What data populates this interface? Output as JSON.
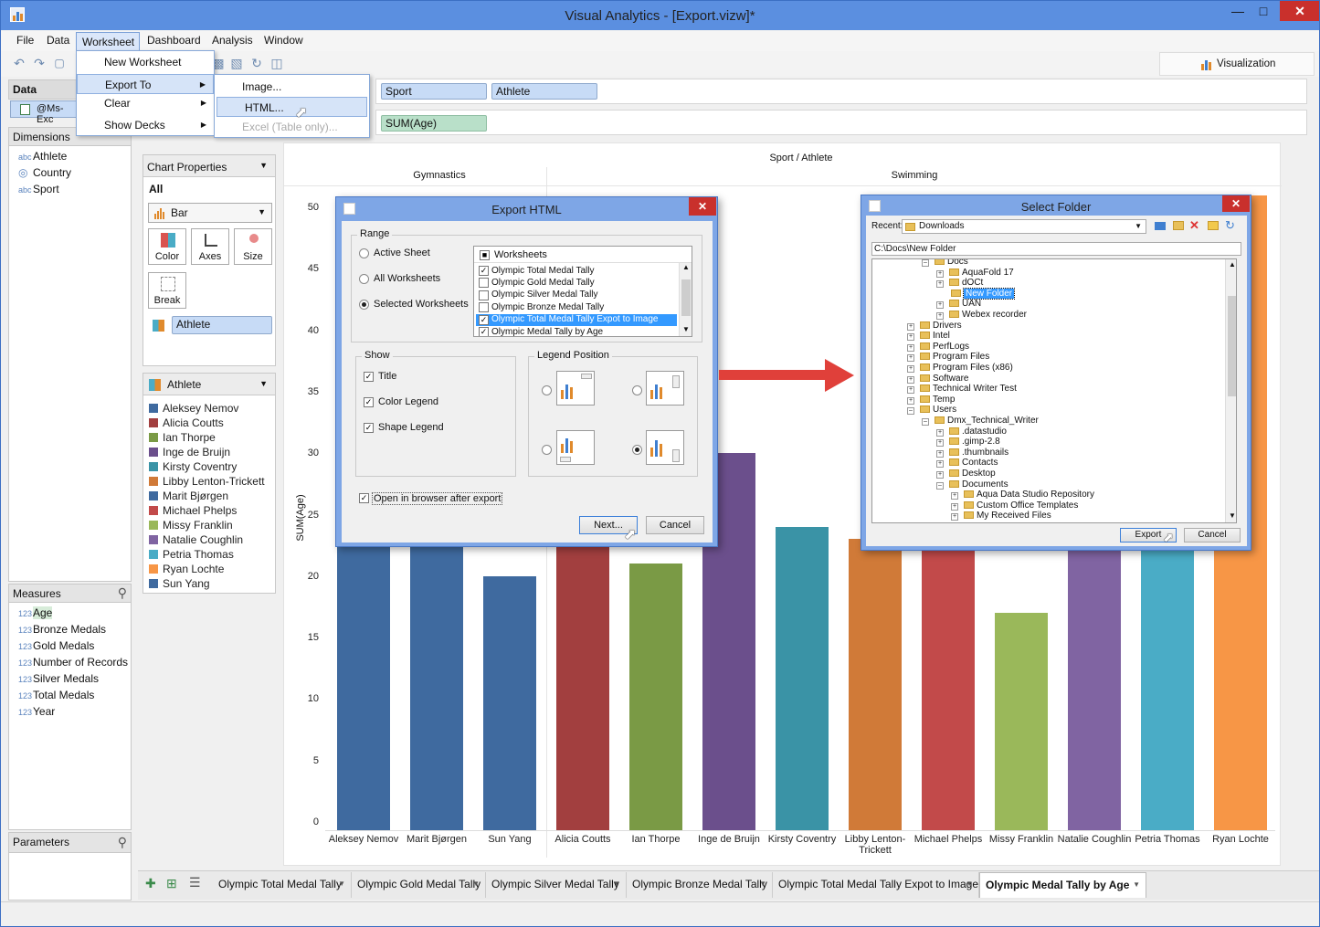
{
  "window": {
    "title": "Visual Analytics - [Export.vizw]*"
  },
  "menubar": [
    "File",
    "Data",
    "Worksheet",
    "Dashboard",
    "Analysis",
    "Window"
  ],
  "worksheet_menu": {
    "items": [
      "New Worksheet",
      "Export To",
      "Clear",
      "Show Decks"
    ],
    "export_submenu": [
      "Image...",
      "HTML...",
      "Excel (Table only)..."
    ]
  },
  "toolbar": {
    "visualization_label": "Visualization"
  },
  "data_panel": {
    "title": "Data",
    "connection": "@Ms-Exc",
    "dimensions_title": "Dimensions",
    "dimensions": [
      {
        "type": "abc",
        "name": "Athlete"
      },
      {
        "type": "globe",
        "name": "Country"
      },
      {
        "type": "abc",
        "name": "Sport"
      }
    ],
    "measures_title": "Measures",
    "measures": [
      {
        "type": "123",
        "name": "Age"
      },
      {
        "type": "123",
        "name": "Bronze Medals"
      },
      {
        "type": "123",
        "name": "Gold Medals"
      },
      {
        "type": "123",
        "name": "Number of Records"
      },
      {
        "type": "123",
        "name": "Silver Medals"
      },
      {
        "type": "123",
        "name": "Total Medals"
      },
      {
        "type": "123",
        "name": "Year"
      }
    ],
    "parameters_title": "Parameters"
  },
  "shelves": {
    "columns": [
      "Sport",
      "Athlete"
    ],
    "rows": [
      "SUM(Age)"
    ]
  },
  "chart_properties": {
    "title": "Chart Properties",
    "scope": "All",
    "chart_type": "Bar",
    "buttons": [
      "Color",
      "Axes",
      "Size",
      "Break"
    ],
    "color_field": "Athlete"
  },
  "legend": {
    "title": "Athlete",
    "items": [
      {
        "name": "Aleksey Nemov",
        "color": "#3f6a9f"
      },
      {
        "name": "Alicia Coutts",
        "color": "#a23f3f"
      },
      {
        "name": "Ian Thorpe",
        "color": "#7a9a45"
      },
      {
        "name": "Inge de Bruijn",
        "color": "#6b4f8c"
      },
      {
        "name": "Kirsty Coventry",
        "color": "#3a93a6"
      },
      {
        "name": "Libby Lenton-Trickett",
        "color": "#d07a38"
      },
      {
        "name": "Marit Bjørgen",
        "color": "#3f6a9f"
      },
      {
        "name": "Michael Phelps",
        "color": "#c24a4a"
      },
      {
        "name": "Missy Franklin",
        "color": "#9ab85a"
      },
      {
        "name": "Natalie Coughlin",
        "color": "#8064a2"
      },
      {
        "name": "Petria Thomas",
        "color": "#4aacc6"
      },
      {
        "name": "Ryan Lochte",
        "color": "#f79646"
      },
      {
        "name": "Sun Yang",
        "color": "#3f6a9f"
      }
    ]
  },
  "chart_data": {
    "type": "bar",
    "title": "Sport / Athlete",
    "ylabel": "SUM(Age)",
    "ylim": [
      0,
      50
    ],
    "yticks": [
      0,
      5,
      10,
      15,
      20,
      25,
      30,
      35,
      40,
      45,
      50
    ],
    "groups": [
      {
        "name": "Gymnastics",
        "count": 3
      },
      {
        "name": "Swimming",
        "count": 10
      }
    ],
    "categories": [
      "Aleksey Nemov",
      "Marit Bjørgen",
      "Sun Yang",
      "Alicia Coutts",
      "Ian Thorpe",
      "Inge de Bruijn",
      "Kirsty Coventry",
      "Libby Lenton-Trickett",
      "Michael Phelps",
      "Missy Franklin",
      "Natalie Coughlin",
      "Petria Thomas",
      "Ryan Lochte"
    ],
    "values": [
      28,
      28,
      20,
      28,
      21,
      30,
      24,
      23,
      28,
      17,
      28,
      28,
      51
    ],
    "colors": [
      "#3f6a9f",
      "#3f6a9f",
      "#3f6a9f",
      "#a23f3f",
      "#7a9a45",
      "#6b4f8c",
      "#3a93a6",
      "#d07a38",
      "#c24a4a",
      "#9ab85a",
      "#8064a2",
      "#4aacc6",
      "#f79646"
    ]
  },
  "export_html_dialog": {
    "title": "Export HTML",
    "range_title": "Range",
    "range_options": [
      "Active Sheet",
      "All Worksheets",
      "Selected Worksheets"
    ],
    "selected_range": "Selected Worksheets",
    "worksheets_header": "Worksheets",
    "worksheets": [
      {
        "name": "Olympic Total Medal Tally",
        "checked": true
      },
      {
        "name": "Olympic Gold Medal Tally",
        "checked": false
      },
      {
        "name": "Olympic Silver Medal Tally",
        "checked": false
      },
      {
        "name": "Olympic Bronze Medal Tally",
        "checked": false
      },
      {
        "name": "Olympic Total Medal Tally Expot to Image",
        "checked": true
      },
      {
        "name": "Olympic Medal Tally by Age",
        "checked": true
      }
    ],
    "show_title": "Show",
    "show_options": [
      "Title",
      "Color Legend",
      "Shape Legend"
    ],
    "legend_position_title": "Legend Position",
    "open_in_browser": "Open in browser after export",
    "next_label": "Next...",
    "cancel_label": "Cancel"
  },
  "select_folder_dialog": {
    "title": "Select Folder",
    "recent_label": "Recent:",
    "recent_value": "Downloads",
    "path": "C:\\Docs\\New Folder",
    "tree": [
      {
        "level": 2,
        "name": "Docs",
        "sign": "-"
      },
      {
        "level": 3,
        "name": "AquaFold 17",
        "sign": "+"
      },
      {
        "level": 3,
        "name": "dOCt",
        "sign": "+"
      },
      {
        "level": 3,
        "name": "New Folder",
        "sign": "",
        "selected": true
      },
      {
        "level": 3,
        "name": "UAN",
        "sign": "+"
      },
      {
        "level": 3,
        "name": "Webex recorder",
        "sign": "+"
      },
      {
        "level": 1,
        "name": "Drivers",
        "sign": "+"
      },
      {
        "level": 1,
        "name": "Intel",
        "sign": "+"
      },
      {
        "level": 1,
        "name": "PerfLogs",
        "sign": "+"
      },
      {
        "level": 1,
        "name": "Program Files",
        "sign": "+"
      },
      {
        "level": 1,
        "name": "Program Files (x86)",
        "sign": "+"
      },
      {
        "level": 1,
        "name": "Software",
        "sign": "+"
      },
      {
        "level": 1,
        "name": "Technical Writer Test",
        "sign": "+"
      },
      {
        "level": 1,
        "name": "Temp",
        "sign": "+"
      },
      {
        "level": 1,
        "name": "Users",
        "sign": "-"
      },
      {
        "level": 2,
        "name": "Dmx_Technical_Writer",
        "sign": "-"
      },
      {
        "level": 3,
        "name": ".datastudio",
        "sign": "+"
      },
      {
        "level": 3,
        "name": ".gimp-2.8",
        "sign": "+"
      },
      {
        "level": 3,
        "name": ".thumbnails",
        "sign": "+"
      },
      {
        "level": 3,
        "name": "Contacts",
        "sign": "+"
      },
      {
        "level": 3,
        "name": "Desktop",
        "sign": "+"
      },
      {
        "level": 3,
        "name": "Documents",
        "sign": "-"
      },
      {
        "level": 4,
        "name": "Aqua Data Studio Repository",
        "sign": "+"
      },
      {
        "level": 4,
        "name": "Custom Office Templates",
        "sign": "+"
      },
      {
        "level": 4,
        "name": "My Received Files",
        "sign": "+"
      }
    ],
    "export_label": "Export",
    "cancel_label": "Cancel"
  },
  "tabs": [
    {
      "name": "Olympic Total Medal Tally",
      "active": false
    },
    {
      "name": "Olympic Gold Medal Tally",
      "active": false
    },
    {
      "name": "Olympic Silver Medal Tally",
      "active": false
    },
    {
      "name": "Olympic Bronze Medal Tally",
      "active": false
    },
    {
      "name": "Olympic Total Medal Tally Expot to Image",
      "active": false
    },
    {
      "name": "Olympic Medal Tally by Age",
      "active": true
    }
  ],
  "colors": {
    "accent": "#5b8fe0",
    "arrow": "#e0403a"
  }
}
